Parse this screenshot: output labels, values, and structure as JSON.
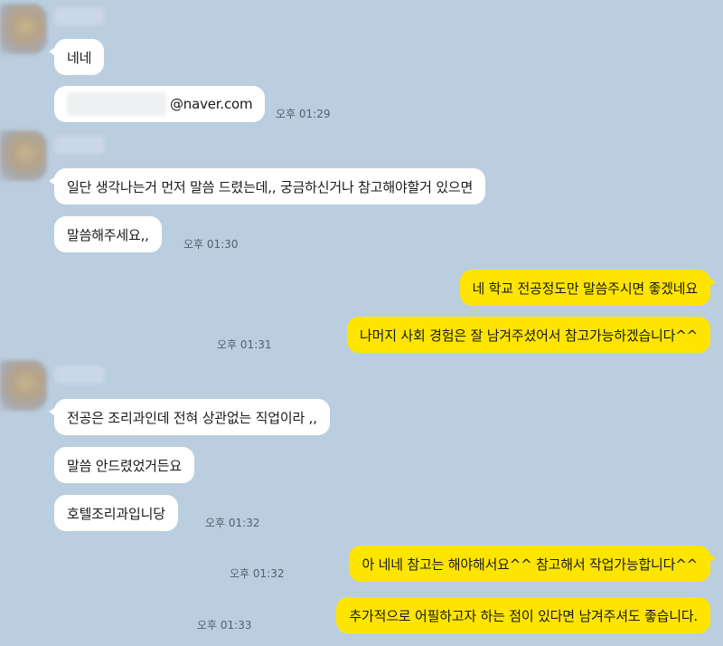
{
  "chat": {
    "messages": [
      {
        "text": "네네",
        "time": ""
      },
      {
        "text": "@naver.com",
        "time": "오후 01:29"
      },
      {
        "text": "일단 생각나는거 먼저 말씀 드렸는데,, 궁금하신거나 참고해야할거 있으면",
        "time": ""
      },
      {
        "text": "말씀해주세요,,",
        "time": "오후 01:30"
      },
      {
        "text": "네 학교 전공정도만 말씀주시면 좋겠네요",
        "time": ""
      },
      {
        "text": "나머지 사회 경험은 잘 남겨주셨어서 참고가능하겠습니다^^",
        "time": "오후 01:31"
      },
      {
        "text": "전공은 조리과인데 전혀 상관없는 직업이라 ,,",
        "time": ""
      },
      {
        "text": "말씀 안드렸었거든요",
        "time": ""
      },
      {
        "text": "호텔조리과입니당",
        "time": "오후 01:32"
      },
      {
        "text": "아 네네 참고는 해야해서요^^ 참고해서 작업가능합니다^^",
        "time": "오후 01:32"
      },
      {
        "text": "추가적으로 어필하고자 하는 점이 있다면 남겨주셔도 좋습니다.",
        "time": "오후 01:33"
      }
    ]
  }
}
